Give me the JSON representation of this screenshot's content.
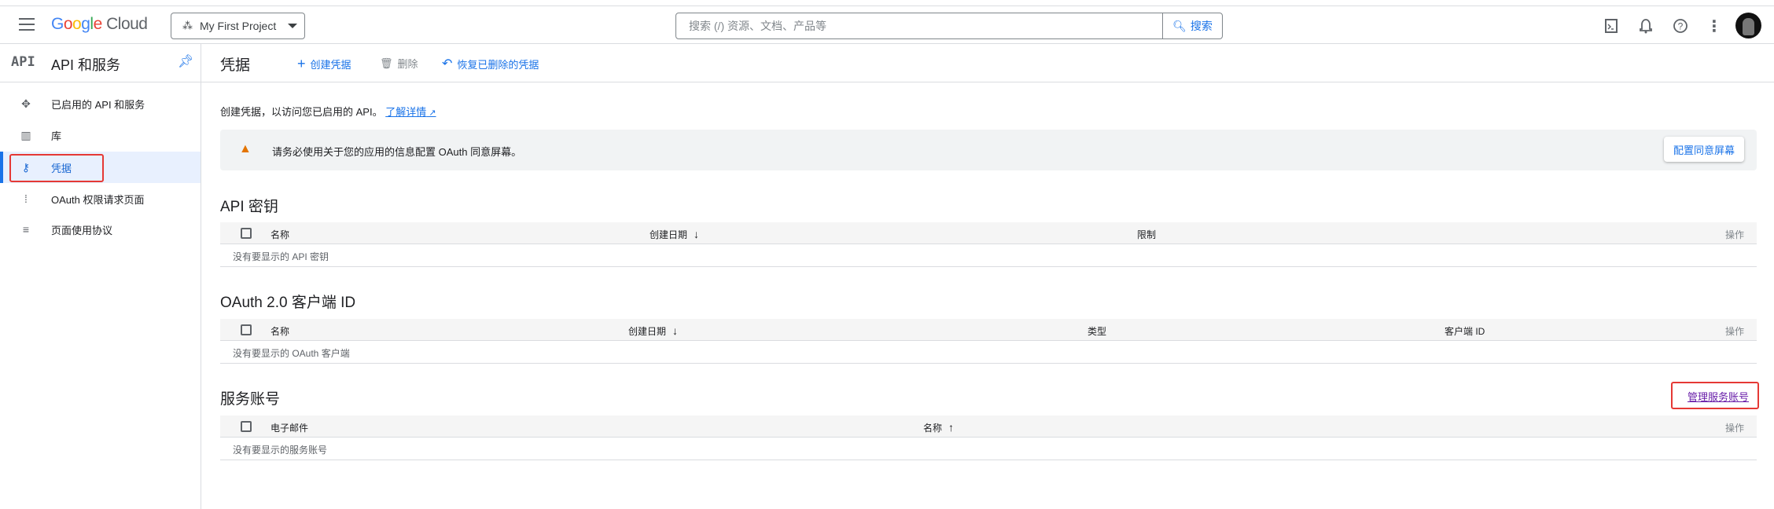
{
  "header": {
    "logo": {
      "google": "Google",
      "cloud": "Cloud"
    },
    "project": "My First Project",
    "search_placeholder": "搜索 (/) 资源、文档、产品等",
    "search_button": "搜索"
  },
  "sidebar": {
    "api_icon_text": "API",
    "title": "API 和服务",
    "items": [
      {
        "label": "已启用的 API 和服务"
      },
      {
        "label": "库"
      },
      {
        "label": "凭据"
      },
      {
        "label": "OAuth 权限请求页面"
      },
      {
        "label": "页面使用协议"
      }
    ]
  },
  "main": {
    "title": "凭据",
    "actions": {
      "create": "创建凭据",
      "delete": "删除",
      "restore": "恢复已删除的凭据"
    },
    "description": "创建凭据，以访问您已启用的 API。",
    "learn_more": "了解详情",
    "warning": {
      "text": "请务必使用关于您的应用的信息配置 OAuth 同意屏幕。",
      "button": "配置同意屏幕"
    },
    "api_keys": {
      "title": "API 密钥",
      "columns": [
        "名称",
        "创建日期",
        "限制",
        "操作"
      ],
      "empty": "没有要显示的 API 密钥"
    },
    "oauth": {
      "title": "OAuth 2.0 客户端 ID",
      "columns": [
        "名称",
        "创建日期",
        "类型",
        "客户端 ID",
        "操作"
      ],
      "empty": "没有要显示的 OAuth 客户端"
    },
    "service_accounts": {
      "title": "服务账号",
      "manage_link": "管理服务账号",
      "columns": [
        "电子邮件",
        "名称",
        "操作"
      ],
      "empty": "没有要显示的服务账号"
    }
  },
  "colors": {
    "accent": "#1a73e8",
    "highlight": "#e53935",
    "warning": "#e37400"
  }
}
